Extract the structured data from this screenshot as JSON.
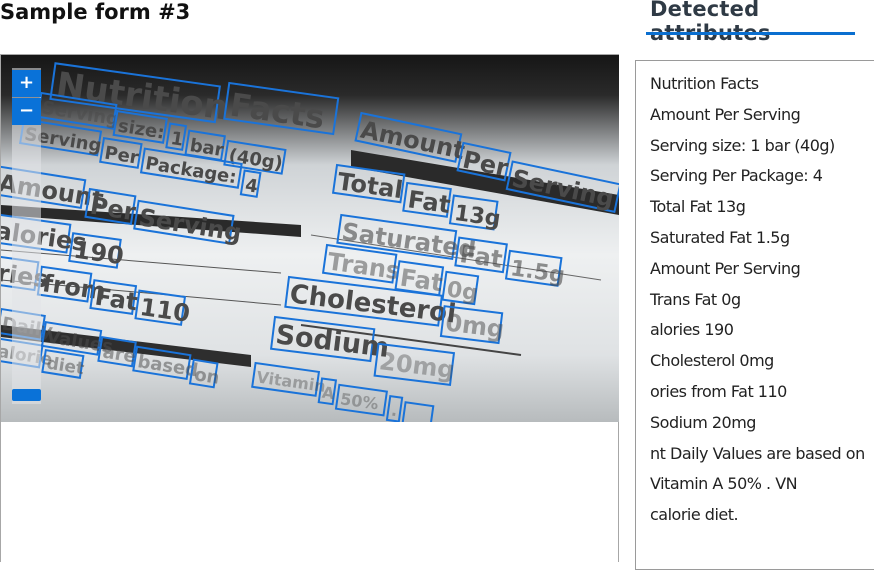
{
  "form_title": "Sample form #3",
  "attributes_header": "Detected attributes",
  "zoom": {
    "in_label": "+",
    "out_label": "−"
  },
  "image_text": {
    "t1": "Nutrition",
    "t2": "Facts",
    "t3": "Serving",
    "t4": "size:",
    "t5": "1",
    "t6": "bar",
    "t7": "(40g)",
    "t8": "Serving",
    "t9": "Per",
    "t10": "Package:",
    "t11": "4",
    "t12": "Amount",
    "t13": "Per",
    "t14": "Serving",
    "t15": "Amount",
    "t16": "Per",
    "t17": "Serving",
    "t18": "Total",
    "t19": "Fat",
    "t20": "13g",
    "t21": "alories",
    "t22": "190",
    "t23": "Saturated",
    "t24": "Fat",
    "t25": "1.5g",
    "t26": "ries",
    "t27": "from",
    "t28": "Fat",
    "t29": "110",
    "t30": "Trans",
    "t31": "Fat",
    "t32": "0g",
    "t33": "Cholesterol",
    "t34": "0mg",
    "t35": "Daily",
    "t36": "Values",
    "t37": "are",
    "t38": "based",
    "t39": "on",
    "t40": "alorie",
    "t41": "diet",
    "t42": "Sodium",
    "t43": "20mg",
    "t44": "Vitamin",
    "t45": "A",
    "t46": "50%",
    "t47": "."
  },
  "attributes": [
    "Nutrition Facts",
    "Amount Per Serving",
    "Serving size: 1 bar (40g)",
    "Serving Per Package: 4",
    "Total Fat 13g",
    "Saturated Fat 1.5g",
    "Amount Per Serving",
    "Trans Fat 0g",
    "alories 190",
    "Cholesterol 0mg",
    "ories from Fat 110",
    "Sodium 20mg",
    "nt Daily Values are based on",
    "Vitamin A 50% . VN",
    "calorie diet."
  ]
}
